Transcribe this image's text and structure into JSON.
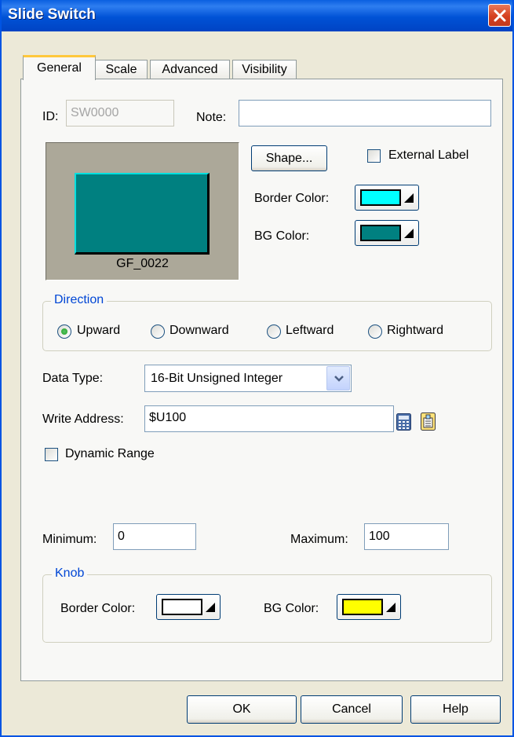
{
  "window": {
    "title": "Slide Switch"
  },
  "tabs": [
    "General",
    "Scale",
    "Advanced",
    "Visibility"
  ],
  "general": {
    "id_label": "ID:",
    "id_value": "SW0000",
    "note_label": "Note:",
    "note_value": "",
    "shape_button": "Shape...",
    "external_label": "External Label",
    "border_color_label": "Border Color:",
    "border_color": "#00ffff",
    "bg_color_label": "BG Color:",
    "bg_color": "#008080",
    "preview_caption": "GF_0022"
  },
  "direction": {
    "title": "Direction",
    "options": [
      "Upward",
      "Downward",
      "Leftward",
      "Rightward"
    ],
    "selected": "Upward"
  },
  "data_type": {
    "label": "Data Type:",
    "value": "16-Bit Unsigned Integer"
  },
  "write_address": {
    "label": "Write Address:",
    "value": "$U100"
  },
  "dynamic_range": {
    "label": "Dynamic Range",
    "checked": false
  },
  "range": {
    "min_label": "Minimum:",
    "min_value": "0",
    "max_label": "Maximum:",
    "max_value": "100"
  },
  "knob": {
    "title": "Knob",
    "border_color_label": "Border Color:",
    "border_color": "#ffffff",
    "bg_color_label": "BG Color:",
    "bg_color": "#ffff00"
  },
  "buttons": {
    "ok": "OK",
    "cancel": "Cancel",
    "help": "Help"
  }
}
